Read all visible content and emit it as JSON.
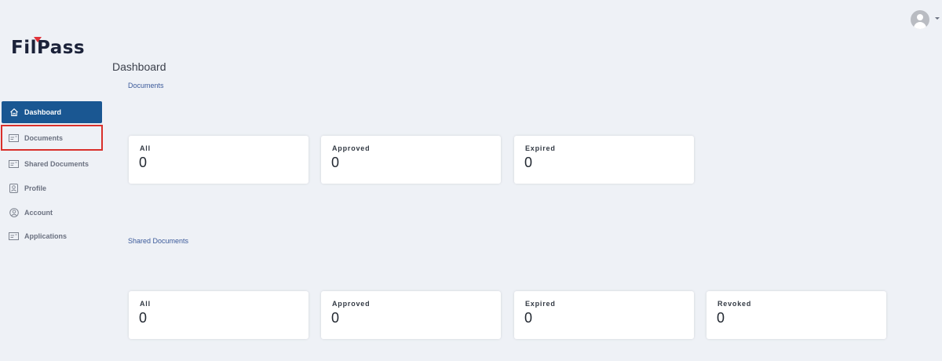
{
  "app": {
    "logo_text": "FilPass"
  },
  "sidebar": {
    "items": [
      {
        "label": "Dashboard",
        "icon": "home-icon",
        "active": true
      },
      {
        "label": "Documents",
        "icon": "document-card-icon",
        "highlighted": true
      },
      {
        "label": "Shared Documents",
        "icon": "document-card-icon"
      },
      {
        "label": "Profile",
        "icon": "profile-badge-icon"
      },
      {
        "label": "Account",
        "icon": "user-circle-icon"
      },
      {
        "label": "Applications",
        "icon": "document-card-icon"
      }
    ]
  },
  "header": {
    "avatar_icon": "user-avatar-icon",
    "menu_icon": "caret-down-icon"
  },
  "main": {
    "page_title": "Dashboard",
    "documents": {
      "section_title": "Documents",
      "cards": [
        {
          "label": "All",
          "value": "0"
        },
        {
          "label": "Approved",
          "value": "0"
        },
        {
          "label": "Expired",
          "value": "0"
        }
      ]
    },
    "shared_documents": {
      "section_title": "Shared Documents",
      "cards": [
        {
          "label": "All",
          "value": "0"
        },
        {
          "label": "Approved",
          "value": "0"
        },
        {
          "label": "Expired",
          "value": "0"
        },
        {
          "label": "Revoked",
          "value": "0"
        }
      ]
    }
  },
  "colors": {
    "background": "#eef1f6",
    "active_nav": "#1a5792",
    "highlight_outline": "#d9302b",
    "section_title": "#3b5a9a",
    "logo_accent": "#e0323a"
  }
}
